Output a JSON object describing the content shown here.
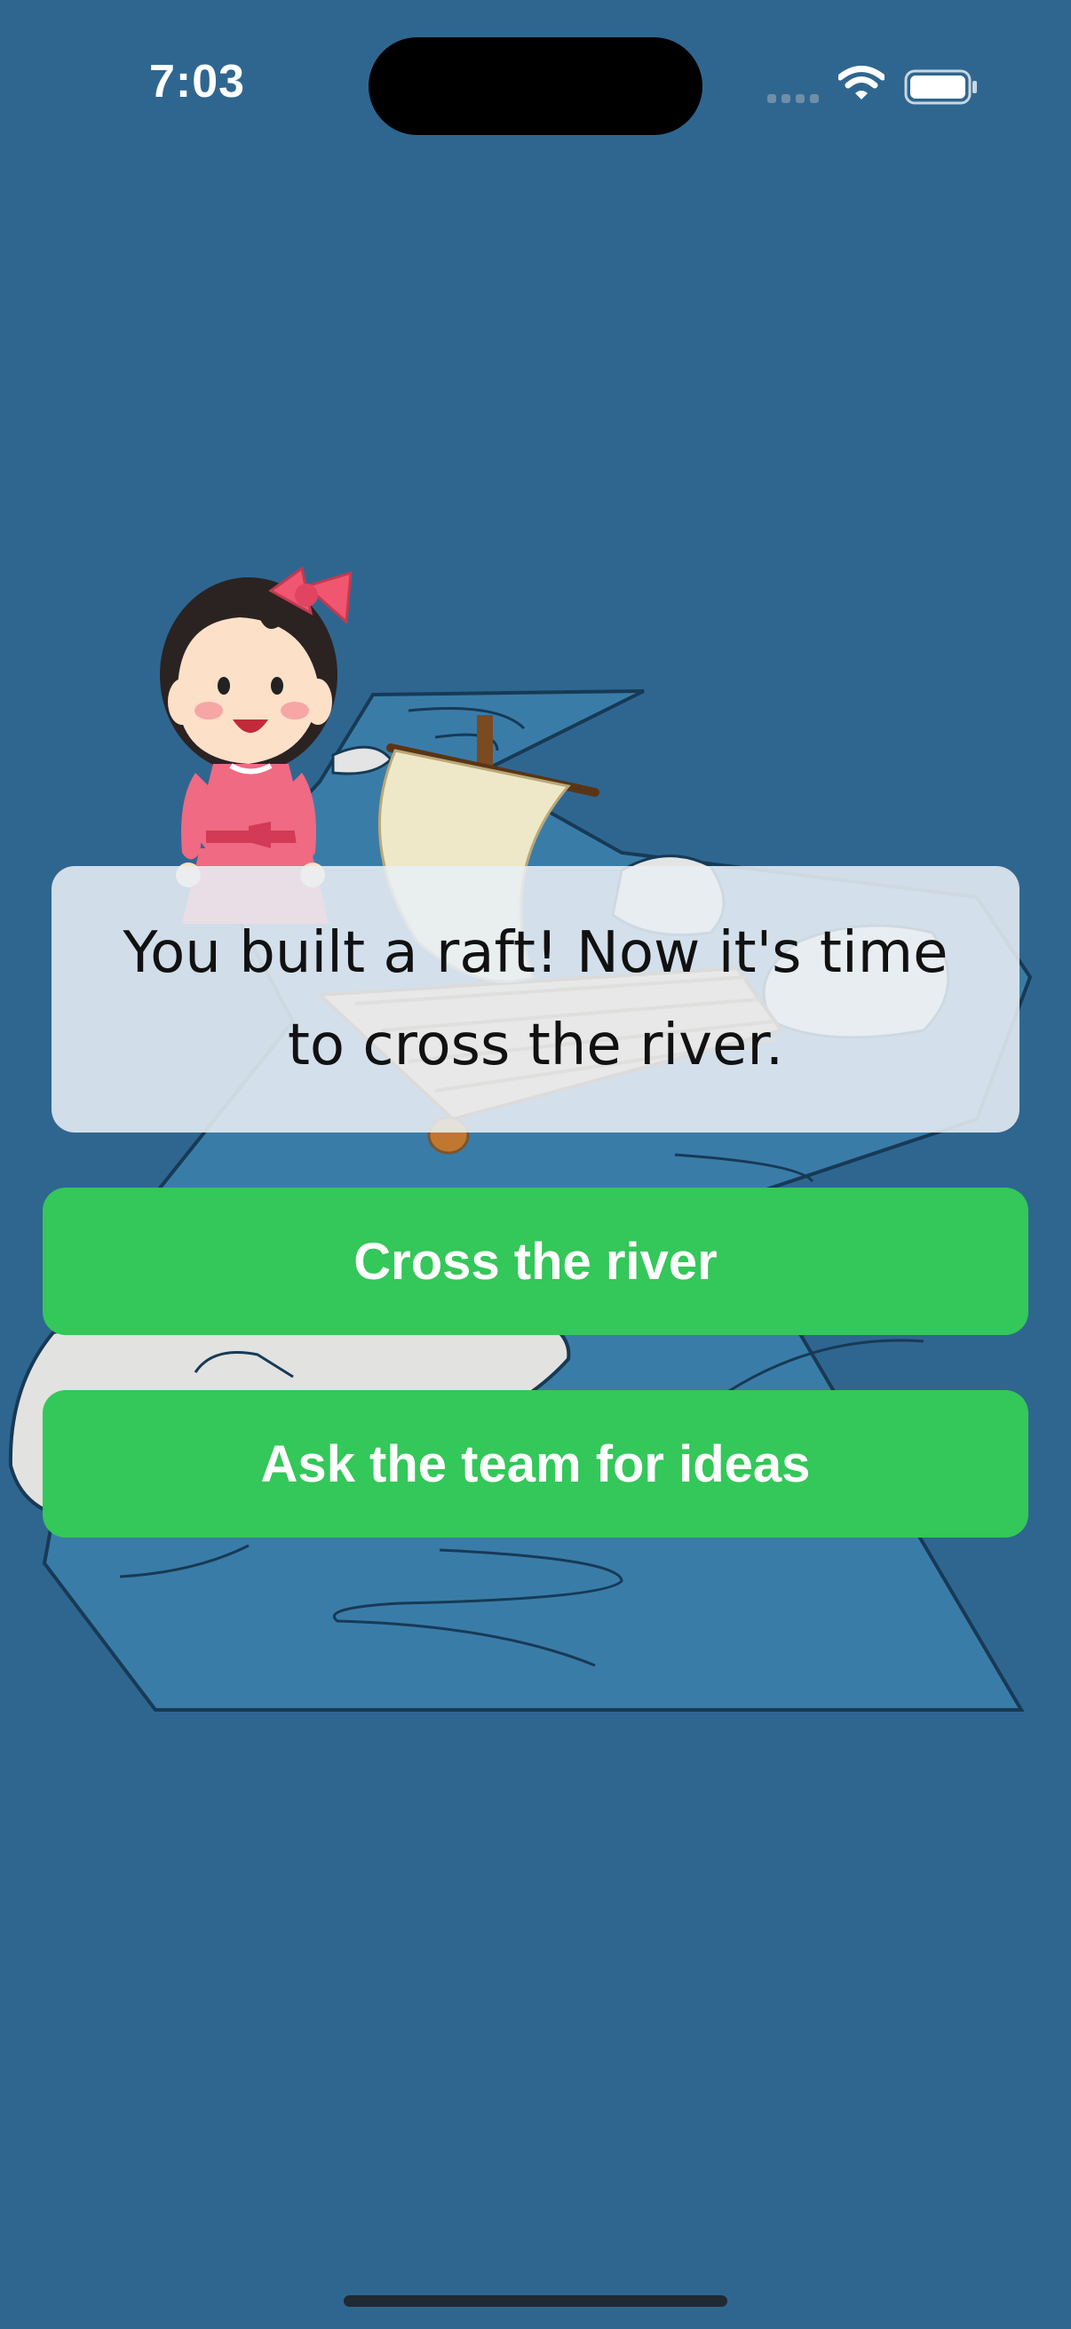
{
  "status_bar": {
    "time": "7:03"
  },
  "dialog": {
    "text": "You built a raft! Now it's time to cross the river."
  },
  "choices": [
    {
      "label": "Cross the river"
    },
    {
      "label": "Ask the team for ideas"
    }
  ],
  "colors": {
    "background": "#2f6690",
    "river": "#3a7ca8",
    "choice_button": "#34c759",
    "dialog_panel": "#e8eef4"
  }
}
